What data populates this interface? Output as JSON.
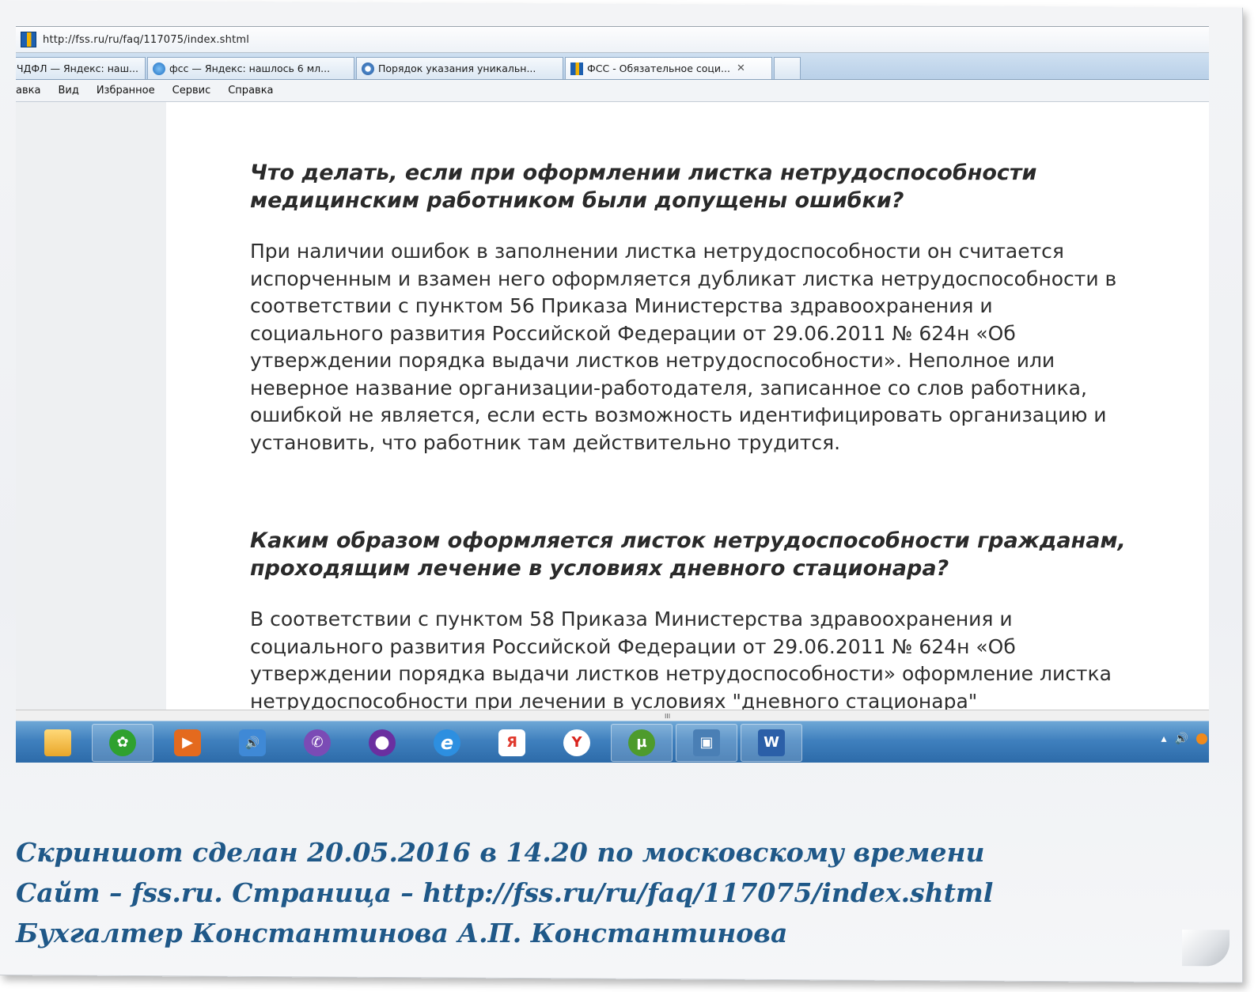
{
  "browser": {
    "address": "http://fss.ru/ru/faq/117075/index.shtml",
    "tabs": [
      {
        "label": "ЧДФЛ — Яндекс: наш...",
        "icon": "yandex-icon",
        "active": false
      },
      {
        "label": "фсс — Яндекс: нашлось 6 мл...",
        "icon": "ie-icon",
        "active": false
      },
      {
        "label": "Порядок указания уникальн...",
        "icon": "globe-icon",
        "active": false
      },
      {
        "label": "ФСС - Обязательное соци...",
        "icon": "fss-icon",
        "active": true,
        "close": "✕"
      }
    ],
    "menu": [
      "авка",
      "Вид",
      "Избранное",
      "Сервис",
      "Справка"
    ]
  },
  "article": {
    "q1": [
      "Что делать, если при оформлении листка нетрудоспособности",
      "медицинским работником были допущены ошибки?"
    ],
    "a1": [
      "При наличии ошибок в заполнении листка нетрудоспособности он считается",
      "испорченным и взамен него оформляется дубликат листка нетрудоспособности в",
      "соответствии с пунктом 56 Приказа Министерства здравоохранения и",
      "социального развития Российской Федерации от 29.06.2011 № 624н «Об",
      "утверждении порядка выдачи листков нетрудоспособности». Неполное или",
      "неверное название организации-работодателя, записанное со слов работника,",
      "ошибкой не является, если есть возможность идентифицировать организацию и",
      "установить, что работник там действительно трудится."
    ],
    "q2": [
      "Каким образом оформляется листок нетрудоспособности гражданам,",
      "проходящим лечение в условиях дневного стационара?"
    ],
    "a2": [
      "В соответствии с пунктом 58 Приказа Министерства здравоохранения и",
      "социального развития Российской Федерации от 29.06.2011 № 624н «Об",
      "утверждении порядка выдачи листков нетрудоспособности» оформление листка",
      "нетрудоспособности при лечении в условиях \"дневного стационара\""
    ]
  },
  "scrollbar": {
    "grip": "III"
  },
  "taskbar": {
    "items": [
      {
        "icon": "folder-icon",
        "glyph": "",
        "color": "#f2b43a"
      },
      {
        "icon": "icq-icon",
        "glyph": "✿",
        "color": "#2fa12f"
      },
      {
        "icon": "media-player-icon",
        "glyph": "▶",
        "color": "#e46a1e"
      },
      {
        "icon": "speaker-icon",
        "glyph": "🔊",
        "color": "#3f89d6"
      },
      {
        "icon": "viber-icon",
        "glyph": "✆",
        "color": "#7b4bb5"
      },
      {
        "icon": "tor-icon",
        "glyph": "●",
        "color": "#6a2fa0"
      },
      {
        "icon": "internet-explorer-icon",
        "glyph": "e",
        "color": "#2d8fe0"
      },
      {
        "icon": "yandex-icon",
        "glyph": "Я",
        "color": "#e03a2e"
      },
      {
        "icon": "yandex-browser-icon",
        "glyph": "Y",
        "color": "#d9241d"
      },
      {
        "icon": "utorrent-icon",
        "glyph": "µ",
        "color": "#4e9b2c"
      },
      {
        "icon": "network-icon",
        "glyph": "▣",
        "color": "#4a7fb5"
      },
      {
        "icon": "word-icon",
        "glyph": "W",
        "color": "#2b5fa8"
      }
    ],
    "tray": [
      "▴",
      "🔊"
    ]
  },
  "caption": {
    "line1": "Скриншот сделан 20.05.2016 в 14.20 по московскому времени",
    "line2": "Сайт – fss.ru. Страница – http://fss.ru/ru/faq/117075/index.shtml",
    "line3": "Бухгалтер  Константинова  А.П. Константинова"
  }
}
